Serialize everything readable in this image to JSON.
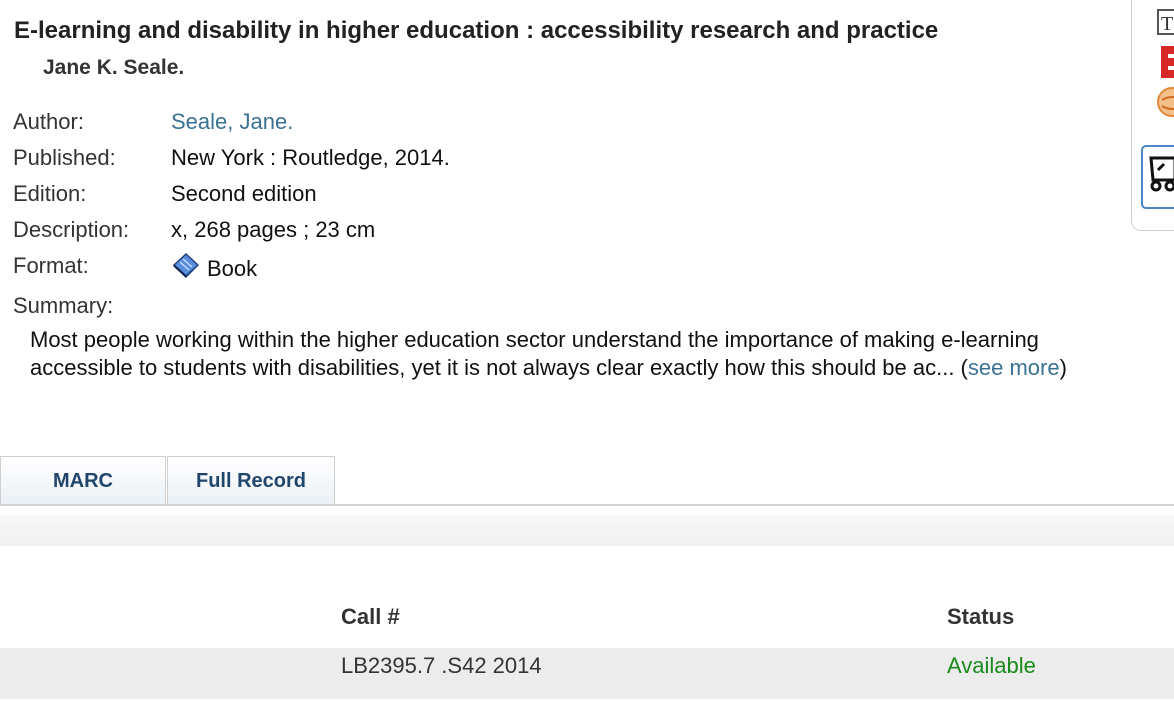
{
  "record": {
    "title": "E-learning and disability in higher education : accessibility research and practice",
    "statement": "Jane K. Seale."
  },
  "fields": {
    "author_label": "Author:",
    "author_value": "Seale, Jane.",
    "published_label": "Published:",
    "published_value": "New York : Routledge, 2014.",
    "edition_label": "Edition:",
    "edition_value": "Second edition",
    "description_label": "Description:",
    "description_value": "x, 268 pages ; 23 cm",
    "format_label": "Format:",
    "format_value": "Book",
    "format_icon": "book-icon",
    "summary_label": "Summary:",
    "summary_text": "Most people working within the higher education sector understand the importance of making e-learning accessible to students with disabilities, yet it is not always clear exactly how this should be ac... (",
    "see_more": "see more",
    "summary_close": ")"
  },
  "tabs": [
    {
      "label": "MARC"
    },
    {
      "label": "Full Record"
    }
  ],
  "holdings": {
    "headers": {
      "call": "Call #",
      "status": "Status"
    },
    "rows": [
      {
        "call": "LB2395.7 .S42 2014",
        "status": "Available"
      }
    ]
  },
  "colors": {
    "link": "#3a7294",
    "tab_text": "#21466b",
    "available": "#1a8a1a"
  },
  "side_icons": [
    "text-icon",
    "red-badge-icon",
    "orange-icon",
    "cart-icon"
  ]
}
